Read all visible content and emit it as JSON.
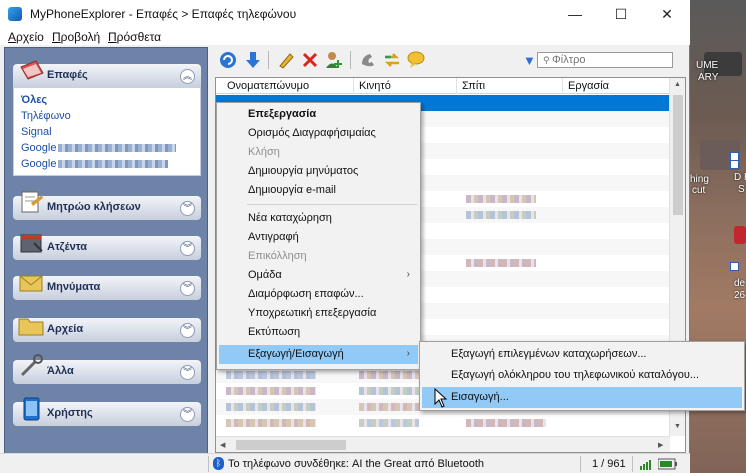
{
  "window": {
    "title": "MyPhoneExplorer -  Επαφές > Επαφές τηλεφώνου",
    "minimize": "—",
    "maximize": "☐",
    "close": "✕"
  },
  "menu": [
    "Αρχείο",
    "Προβολή",
    "Πρόσθετα"
  ],
  "sidebar": {
    "groups": [
      {
        "label": "Επαφές",
        "icon": "contacts-book-icon",
        "expanded": true
      },
      {
        "label": "Μητρώο κλήσεων",
        "icon": "call-log-icon",
        "expanded": false
      },
      {
        "label": "Ατζέντα",
        "icon": "calendar-icon",
        "expanded": false
      },
      {
        "label": "Μηνύματα",
        "icon": "envelope-icon",
        "expanded": false
      },
      {
        "label": "Αρχεία",
        "icon": "folder-icon",
        "expanded": false
      },
      {
        "label": "Άλλα",
        "icon": "tools-icon",
        "expanded": false
      },
      {
        "label": "Χρήστης",
        "icon": "tablet-icon",
        "expanded": false
      }
    ],
    "contact_items": [
      "Όλες",
      "Τηλέφωνο",
      "Signal",
      "Google",
      "Google"
    ],
    "chevron_up": "︽",
    "chevron_down": "︾"
  },
  "toolbar": {
    "icons": [
      "refresh-icon",
      "download-icon",
      "edit-icon",
      "delete-icon",
      "add-contact-icon",
      "phone-icon",
      "sync-icon",
      "chat-icon"
    ],
    "filter_placeholder": "Φίλτρο"
  },
  "grid": {
    "columns": [
      "Ονοματεπώνυμο",
      "Κινητό",
      "Σπίτι",
      "Εργασία"
    ]
  },
  "context_menu": {
    "items": [
      {
        "label": "Επεξεργασία",
        "bold": true
      },
      {
        "label": "Ορισμός Διαγραφήσιμαίας"
      },
      {
        "label": "Κλήση",
        "disabled": true
      },
      {
        "label": "Δημιουργία μηνύματος"
      },
      {
        "label": "Δημιουργία e-mail"
      },
      {
        "label": "Νέα καταχώρηση"
      },
      {
        "label": "Αντιγραφή"
      },
      {
        "label": "Επικόλληση",
        "disabled": true
      },
      {
        "label": "Ομάδα",
        "submenu": true
      },
      {
        "label": "Διαμόρφωση επαφών..."
      },
      {
        "label": "Υποχρεωτική επεξεργασία"
      },
      {
        "label": "Εκτύπωση"
      },
      {
        "label": "Εξαγωγή/Εισαγωγή",
        "submenu": true,
        "highlighted": true
      }
    ],
    "submenu_arrow": "›"
  },
  "submenu": {
    "items": [
      "Εξαγωγή επιλεγμένων καταχωρήσεων...",
      "Εξαγωγή ολόκληρου του τηλεφωνικού καταλόγου...",
      "Εισαγωγή..."
    ]
  },
  "statusbar": {
    "text": "Το τηλέφωνο συνδέθηκε:  AI the Great από Bluetooth",
    "count": "1 / 961"
  },
  "desktop": {
    "labels": [
      "UME",
      "ARY",
      "hing",
      "cut",
      "D R",
      "S",
      "de",
      "26-"
    ]
  },
  "colors": {
    "sidebar_bg": "#6d84a8",
    "selection": "#0078d7",
    "menu_highlight": "#91c9f7",
    "link_text": "#1c4fa6"
  }
}
